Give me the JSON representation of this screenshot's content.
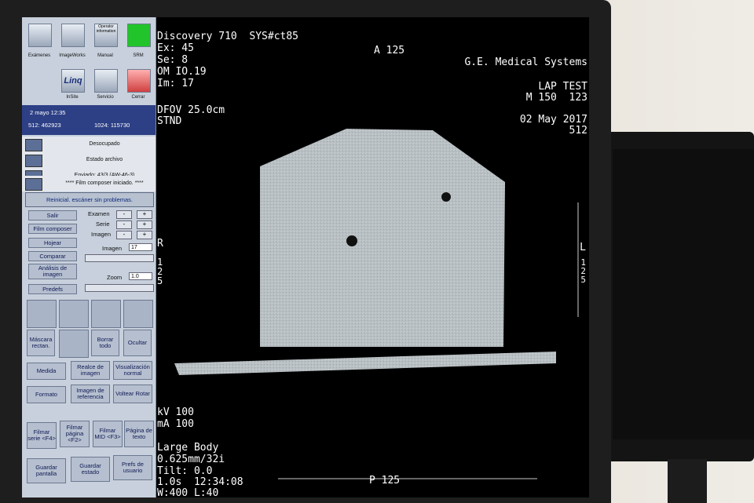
{
  "toolbar": {
    "examenes_label": "Exámenes",
    "imageworks_label": "ImageWorks",
    "operator_label": "Operator information",
    "manual_label": "Manual",
    "srm_label": "SRM",
    "insite_label": "InSite",
    "insite_logo": "Linq",
    "servicio_label": "Servicio",
    "cerrar_label": "Cerrar"
  },
  "info": {
    "datetime": "2 mayo 12:35",
    "left_field": "512:  462923",
    "right_field": "1024:  115730"
  },
  "status": {
    "desocupado": "Desocupado",
    "archivo": "Estado archivo",
    "enviado": "Enviado: 43/3 (AW-46-3)",
    "film": "**** Film composer iniciado. ****"
  },
  "reset_label": "Reinicial. escáner sin problemas.",
  "controls": {
    "salir": "Salir",
    "film_composer": "Film composer",
    "hojear": "Hojear",
    "comparar": "Comparar",
    "analisis": "Análisis de imagen",
    "predefs": "Predefs",
    "examen": "Examen",
    "serie": "Serie",
    "imagen": "Imagen",
    "imagen_field_label": "Imagen",
    "imagen_value": "17",
    "zoom_label": "Zoom",
    "zoom_value": "1.0",
    "minus": "-",
    "plus": "+"
  },
  "actions": {
    "mascara": "Máscara rectan.",
    "borrar": "Borrar todo",
    "ocultar": "Ocultar",
    "medida": "Medida",
    "realce": "Realce de imagen",
    "visualizacion": "Visualización normal",
    "formato": "Formato",
    "imagen_ref": "Imagen de referencia",
    "voltear": "Voltear Rotar",
    "filmar_serie": "Filmar serie <F4>",
    "filmar_pagina": "Filmar página <F2>",
    "filmar_mid": "Filmar MID <F3>",
    "pagina_texto": "Página de texto",
    "guardar_pantalla": "Guardar pantalla",
    "guardar_estado": "Guardar estado",
    "prefs": "Prefs de usuario"
  },
  "overlay": {
    "scanner": "Discovery 710  SYS#ct85",
    "ex": "Ex: 45",
    "se": "Se: 8",
    "om": "OM IO.19",
    "im": "Im: 17",
    "dfov": "DFOV 25.0cm",
    "stnd": "STND",
    "anterior": "A 125",
    "vendor": "G.E. Medical Systems",
    "patient": "LAP TEST",
    "m_value": "M 150  123",
    "date": "02 May 2017",
    "matrix": "512",
    "right_marker": "R",
    "left_marker": "L",
    "scale_left": "1\n2\n5",
    "scale_right": "1\n2\n5",
    "kv": "kV 100",
    "ma": "mA 100",
    "body": "Large Body",
    "thickness": "0.625mm/32i",
    "tilt": "Tilt: 0.0",
    "time": "1.0s  12:34:08",
    "window": "W:400 L:40",
    "posterior": "P 125"
  },
  "colors": {
    "phantom": "#b8bfc2",
    "panel_header": "#2d3f85",
    "srm": "#21c42a"
  }
}
